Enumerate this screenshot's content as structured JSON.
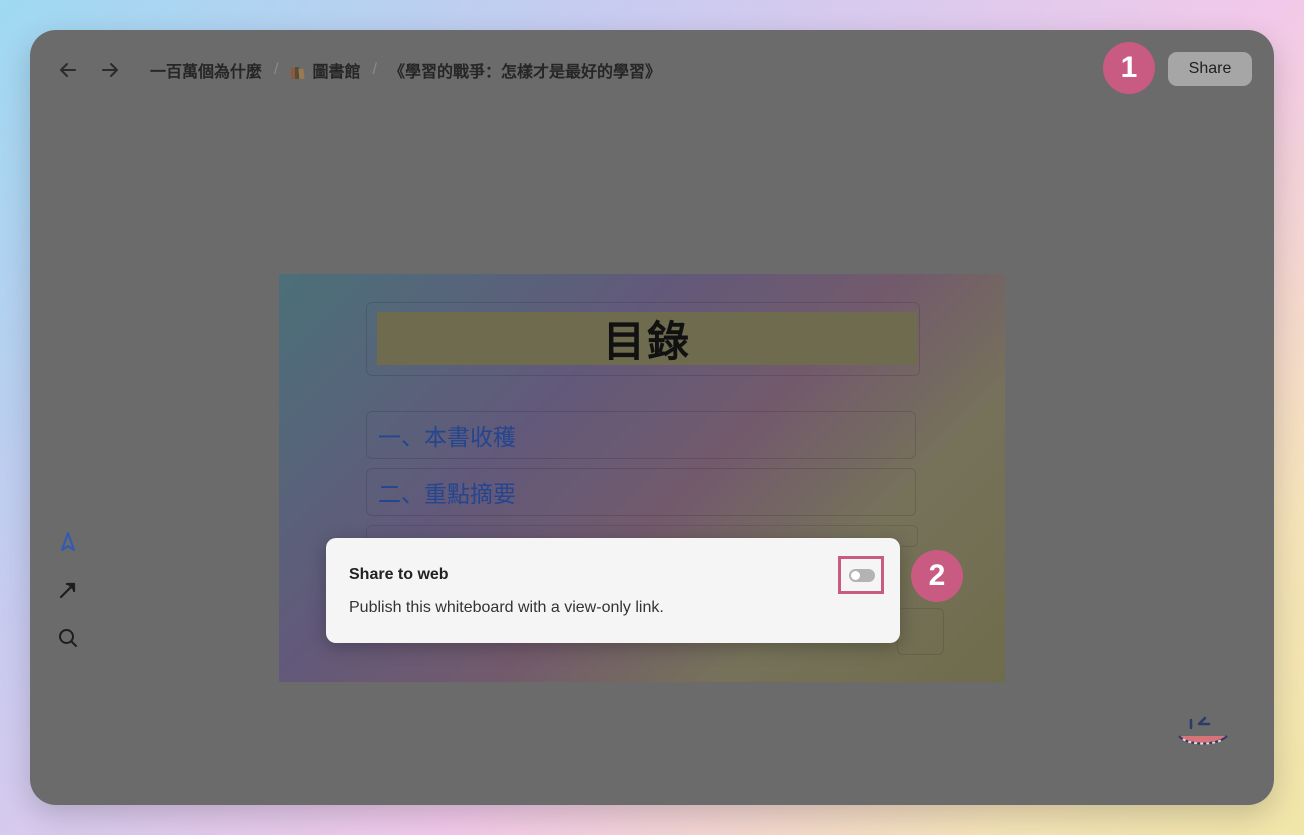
{
  "header": {
    "breadcrumbs": [
      "一百萬個為什麼",
      "圖書館",
      "《學習的戰爭：怎樣才是最好的學習》"
    ],
    "book_icon": "books-icon",
    "separator": "/",
    "share_label": "Share"
  },
  "steps": {
    "one": "1",
    "two": "2"
  },
  "toolbar": {
    "icons": [
      "pointer-icon",
      "arrow-icon",
      "search-icon"
    ]
  },
  "board": {
    "title": "目錄",
    "items": [
      "一、本書收穫",
      "二、重點摘要"
    ]
  },
  "popup": {
    "title": "Share to web",
    "description": "Publish this whiteboard with a view-only link.",
    "toggle_on": false
  },
  "colors": {
    "accent": "#c95a82",
    "overlay": "#6b6b6b",
    "link": "#24458f"
  }
}
